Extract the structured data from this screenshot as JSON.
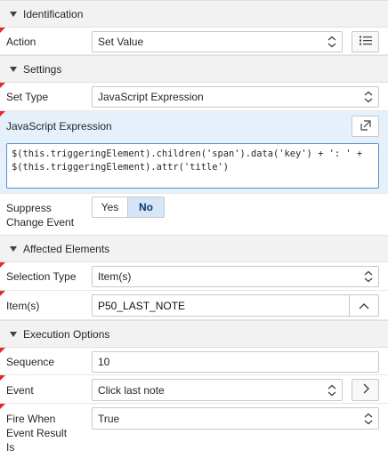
{
  "groups": {
    "identification": "Identification",
    "settings": "Settings",
    "affected": "Affected Elements",
    "execution": "Execution Options"
  },
  "action": {
    "label": "Action",
    "value": "Set Value",
    "list_icon": "list-icon"
  },
  "set_type": {
    "label": "Set Type",
    "value": "JavaScript Expression"
  },
  "js_expression": {
    "label": "JavaScript Expression",
    "code": "$(this.triggeringElement).children('span').data('key') + ': ' + $(this.triggeringElement).attr('title')",
    "expand_icon": "popout-icon"
  },
  "suppress": {
    "label_line1": "Suppress",
    "label_line2": "Change Event",
    "yes": "Yes",
    "no": "No",
    "selected": "No"
  },
  "selection_type": {
    "label": "Selection Type",
    "value": "Item(s)"
  },
  "items": {
    "label": "Item(s)",
    "value": "P50_LAST_NOTE"
  },
  "sequence": {
    "label": "Sequence",
    "value": "10"
  },
  "event": {
    "label": "Event",
    "value": "Click last note"
  },
  "fire_when": {
    "label_line1": "Fire When",
    "label_line2": "Event Result",
    "label_line3": "Is",
    "value": "True"
  },
  "colors": {
    "accent": "#5a8fcf",
    "required": "#e8262f",
    "selected_bg": "#d4e6f8"
  }
}
